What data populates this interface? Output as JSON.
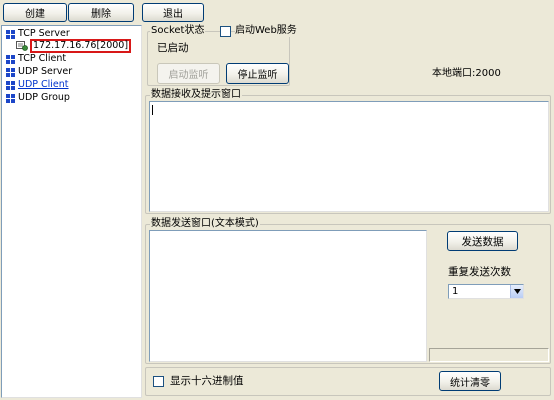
{
  "toolbar": {
    "create": "创建",
    "delete": "删除",
    "exit": "退出"
  },
  "tree": {
    "items": [
      {
        "label": "TCP Server",
        "kind": "root"
      },
      {
        "label": "172.17.16.76[2000]",
        "kind": "connection"
      },
      {
        "label": "TCP Client",
        "kind": "root"
      },
      {
        "label": "UDP Server",
        "kind": "root"
      },
      {
        "label": "UDP Client",
        "kind": "root-link"
      },
      {
        "label": "UDP Group",
        "kind": "root"
      }
    ]
  },
  "socket": {
    "group_title": "Socket状态",
    "web_service_label": "启动Web服务",
    "status": "已启动",
    "start_button": "启动监听",
    "stop_button": "停止监听",
    "port_label": "本地端口:2000"
  },
  "receive": {
    "title": "数据接收及提示窗口"
  },
  "send": {
    "title": "数据发送窗口(文本模式)",
    "send_button": "发送数据",
    "repeat_label": "重复发送次数",
    "repeat_value": "1"
  },
  "bottom": {
    "hex_label": "显示十六进制值",
    "clear_button": "统计清零"
  },
  "colors": {
    "highlight_box": "#d81818",
    "link": "#0033cc",
    "tree_icon": "#1c46c8"
  }
}
